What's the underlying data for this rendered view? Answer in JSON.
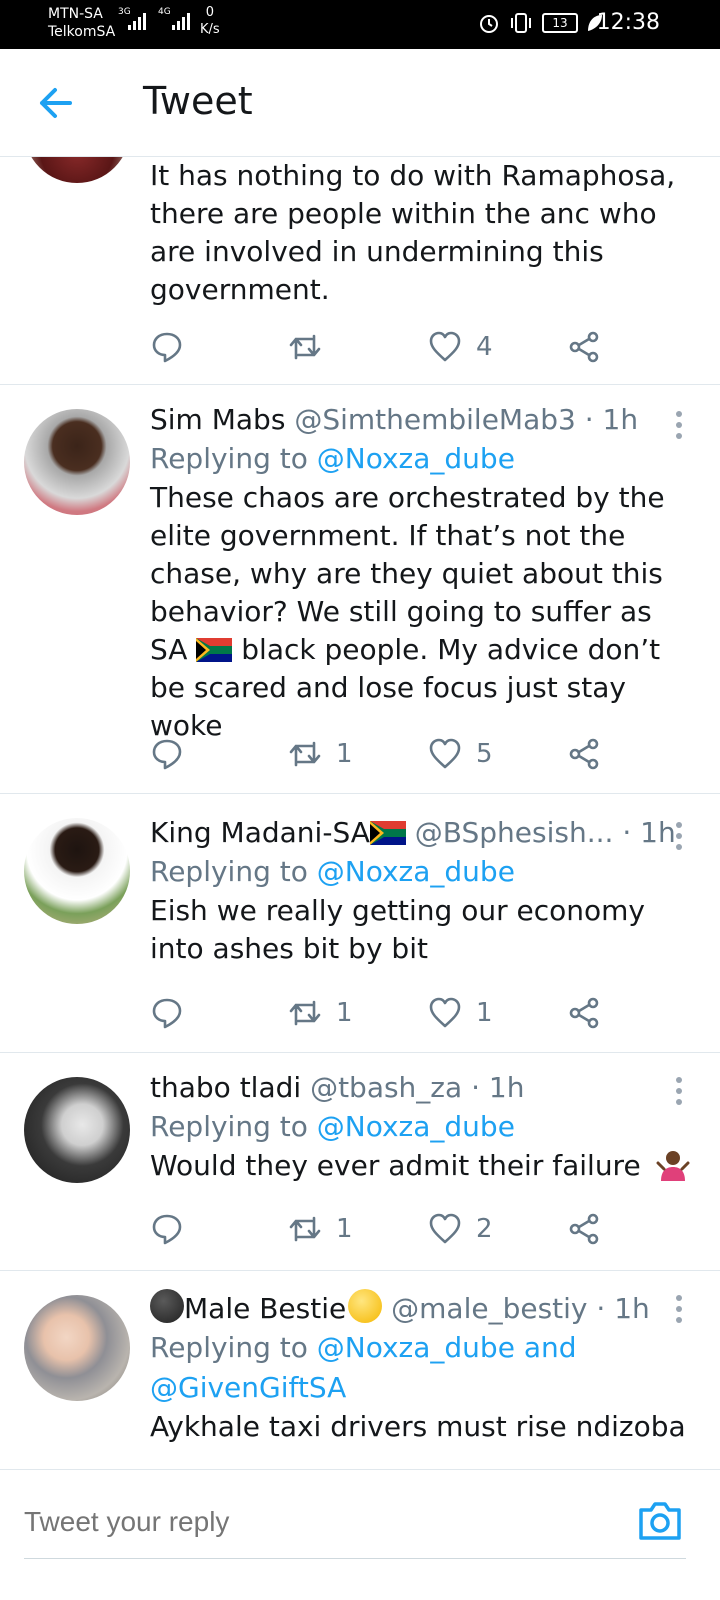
{
  "status_bar": {
    "carrier_1": "MTN-SA",
    "carrier_2": "TelkomSA",
    "network_1": "3G",
    "network_2": "4G",
    "speed_value": "0",
    "speed_unit": "K/s",
    "battery": "13",
    "time": "12:38"
  },
  "header": {
    "title": "Tweet"
  },
  "tweets": [
    {
      "text": "It has nothing to do with Ramaphosa, there are people within the anc who are involved in undermining this government.",
      "reply_count": "",
      "retweet_count": "",
      "like_count": "4"
    },
    {
      "name": "Sim Mabs",
      "handle": "@SimthembileMab3",
      "time": "· 1h",
      "replying_prefix": "Replying to",
      "replying_to": "@Noxza_dube",
      "text_1": "These chaos are orchestrated by the elite government. If that’s not the chase, why are they quiet about this behavior? We still going to suffer as SA",
      "text_2": "black people. My advice don’t be scared and lose focus just stay woke",
      "retweet_count": "1",
      "like_count": "5"
    },
    {
      "name": "King Madani-SA",
      "handle": "@BSphesish...",
      "time": "· 1h",
      "replying_prefix": "Replying to",
      "replying_to": "@Noxza_dube",
      "text": "Eish we really getting our economy into ashes bit by bit",
      "retweet_count": "1",
      "like_count": "1"
    },
    {
      "name": "thabo tladi",
      "handle": "@tbash_za",
      "time": "· 1h",
      "replying_prefix": "Replying to",
      "replying_to": "@Noxza_dube",
      "text": "Would they ever admit their failure",
      "retweet_count": "1",
      "like_count": "2"
    },
    {
      "name": "Male Bestie",
      "handle": "@male_bestiy",
      "time": "· 1h",
      "replying_prefix": "Replying to",
      "replying_to": "@Noxza_dube and",
      "replying_to_2": "@GivenGiftSA",
      "text": "Aykhale taxi drivers must rise ndizoba"
    }
  ],
  "reply_bar": {
    "placeholder": "Tweet your reply"
  },
  "colors": {
    "accent": "#1da1f2",
    "secondary_text": "#657786",
    "divider": "#e1e8ed"
  },
  "icons": [
    "back-arrow-icon",
    "reply-icon",
    "retweet-icon",
    "like-icon",
    "share-icon",
    "more-icon",
    "camera-icon",
    "south-africa-flag-icon"
  ]
}
